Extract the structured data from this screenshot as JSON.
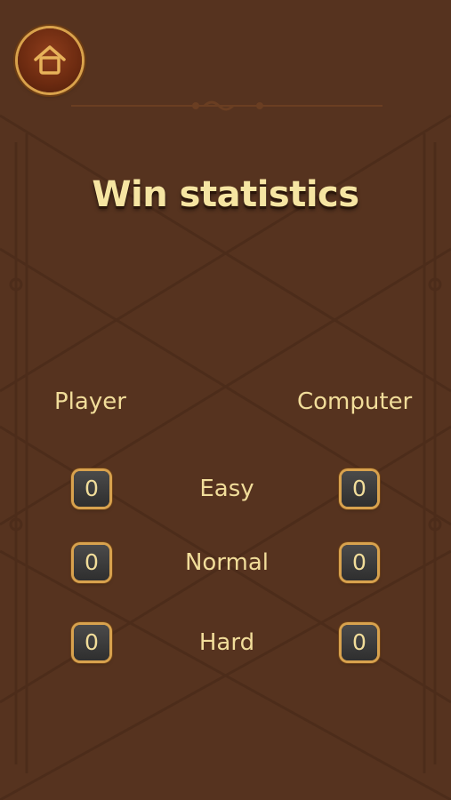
{
  "header": {
    "home_icon": "home-icon",
    "title": "Win statistics"
  },
  "columns": {
    "player": "Player",
    "computer": "Computer"
  },
  "rows": [
    {
      "difficulty": "Easy",
      "player_wins": "0",
      "computer_wins": "0"
    },
    {
      "difficulty": "Normal",
      "player_wins": "0",
      "computer_wins": "0"
    },
    {
      "difficulty": "Hard",
      "player_wins": "0",
      "computer_wins": "0"
    }
  ],
  "colors": {
    "background": "#56331f",
    "text": "#f1dd9a",
    "gold_border": "#d8a24e",
    "score_box": "#3a3a3a"
  }
}
